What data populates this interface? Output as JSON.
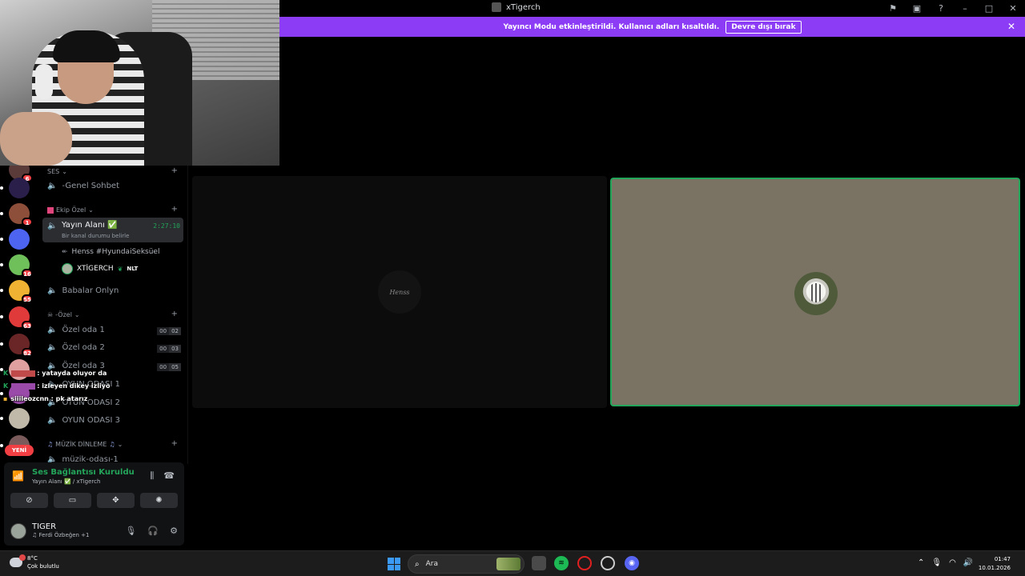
{
  "window": {
    "title": "xTigerch",
    "controls": {
      "minimize": "–",
      "maximize": "□",
      "close": "✕"
    }
  },
  "banner": {
    "message": "Yayıncı Modu etkinleştirildi. Kullanıcı adları kısaltıldı.",
    "disable_label": "Devre dışı bırak",
    "close": "✕"
  },
  "servers": [
    {
      "badge": "6",
      "color": "#5b3a3a"
    },
    {
      "badge": "",
      "color": "#2a1f4a"
    },
    {
      "badge": "1",
      "color": "#8e4f3a"
    },
    {
      "badge": "",
      "color": "#4c64f0"
    },
    {
      "badge": "16",
      "color": "#6fbf5a"
    },
    {
      "badge": "55",
      "color": "#f0b232"
    },
    {
      "badge": "63",
      "color": "#e03a3a"
    },
    {
      "badge": "82",
      "color": "#6a2626"
    },
    {
      "badge": "",
      "color": "#e0a0a0"
    },
    {
      "badge": "",
      "color": "#9a4aa8"
    },
    {
      "badge": "",
      "color": "#c0b8a8"
    },
    {
      "badge": "",
      "color": "#7a5a5a"
    }
  ],
  "rail": {
    "new_label": "YENİ"
  },
  "channels": {
    "cat_ses": "SES",
    "genel": "-Genel Sohbet",
    "cat_ekip": "Ekip Özel",
    "active_name": "Yayın Alanı",
    "active_status": "Bir kanal durumu belirle",
    "active_timer": "2:27:10",
    "member_1": "Henss #HyundaiSeksüel",
    "member_2": "XTİGERCH",
    "member_2_tag": "NLT",
    "babalar": "Babalar Onlyn",
    "cat_ozel": "-Özel",
    "ozel1": "Özel oda 1",
    "ozel1_c": [
      "00",
      "02"
    ],
    "ozel2": "Özel oda 2",
    "ozel2_c": [
      "00",
      "03"
    ],
    "ozel3": "Özel oda 3",
    "ozel3_c": [
      "00",
      "05"
    ],
    "oyun1": "OYUN ODASI 1",
    "oyun2": "OYUN ODASI 2",
    "oyun3": "OYUN ODASI 3",
    "cat_muzik": "MÜZİK DİNLEME",
    "muzik1": "müzik-odası-1"
  },
  "chat": [
    {
      "text": ": yatayda oluyor da"
    },
    {
      "text": ": izleyen dikey izliyo"
    },
    {
      "text": "siiileozcnn : pk atarız"
    }
  ],
  "voice": {
    "status": "Ses Bağlantısı Kuruldu",
    "channel": "Yayın Alanı ✅ / xTigerch",
    "username": "TIGER",
    "activity": "Ferdi Özbeğen +1"
  },
  "stage": {
    "left_avatar_text": "Henss"
  },
  "taskbar": {
    "temp": "8°C",
    "weather": "Çok bulutlu",
    "search": "Ara",
    "time": "01:47",
    "date": "10.01.2026"
  },
  "colors": {
    "banner": "#8d3cf5",
    "speaking": "#23a55a",
    "badge": "#f23f43"
  }
}
